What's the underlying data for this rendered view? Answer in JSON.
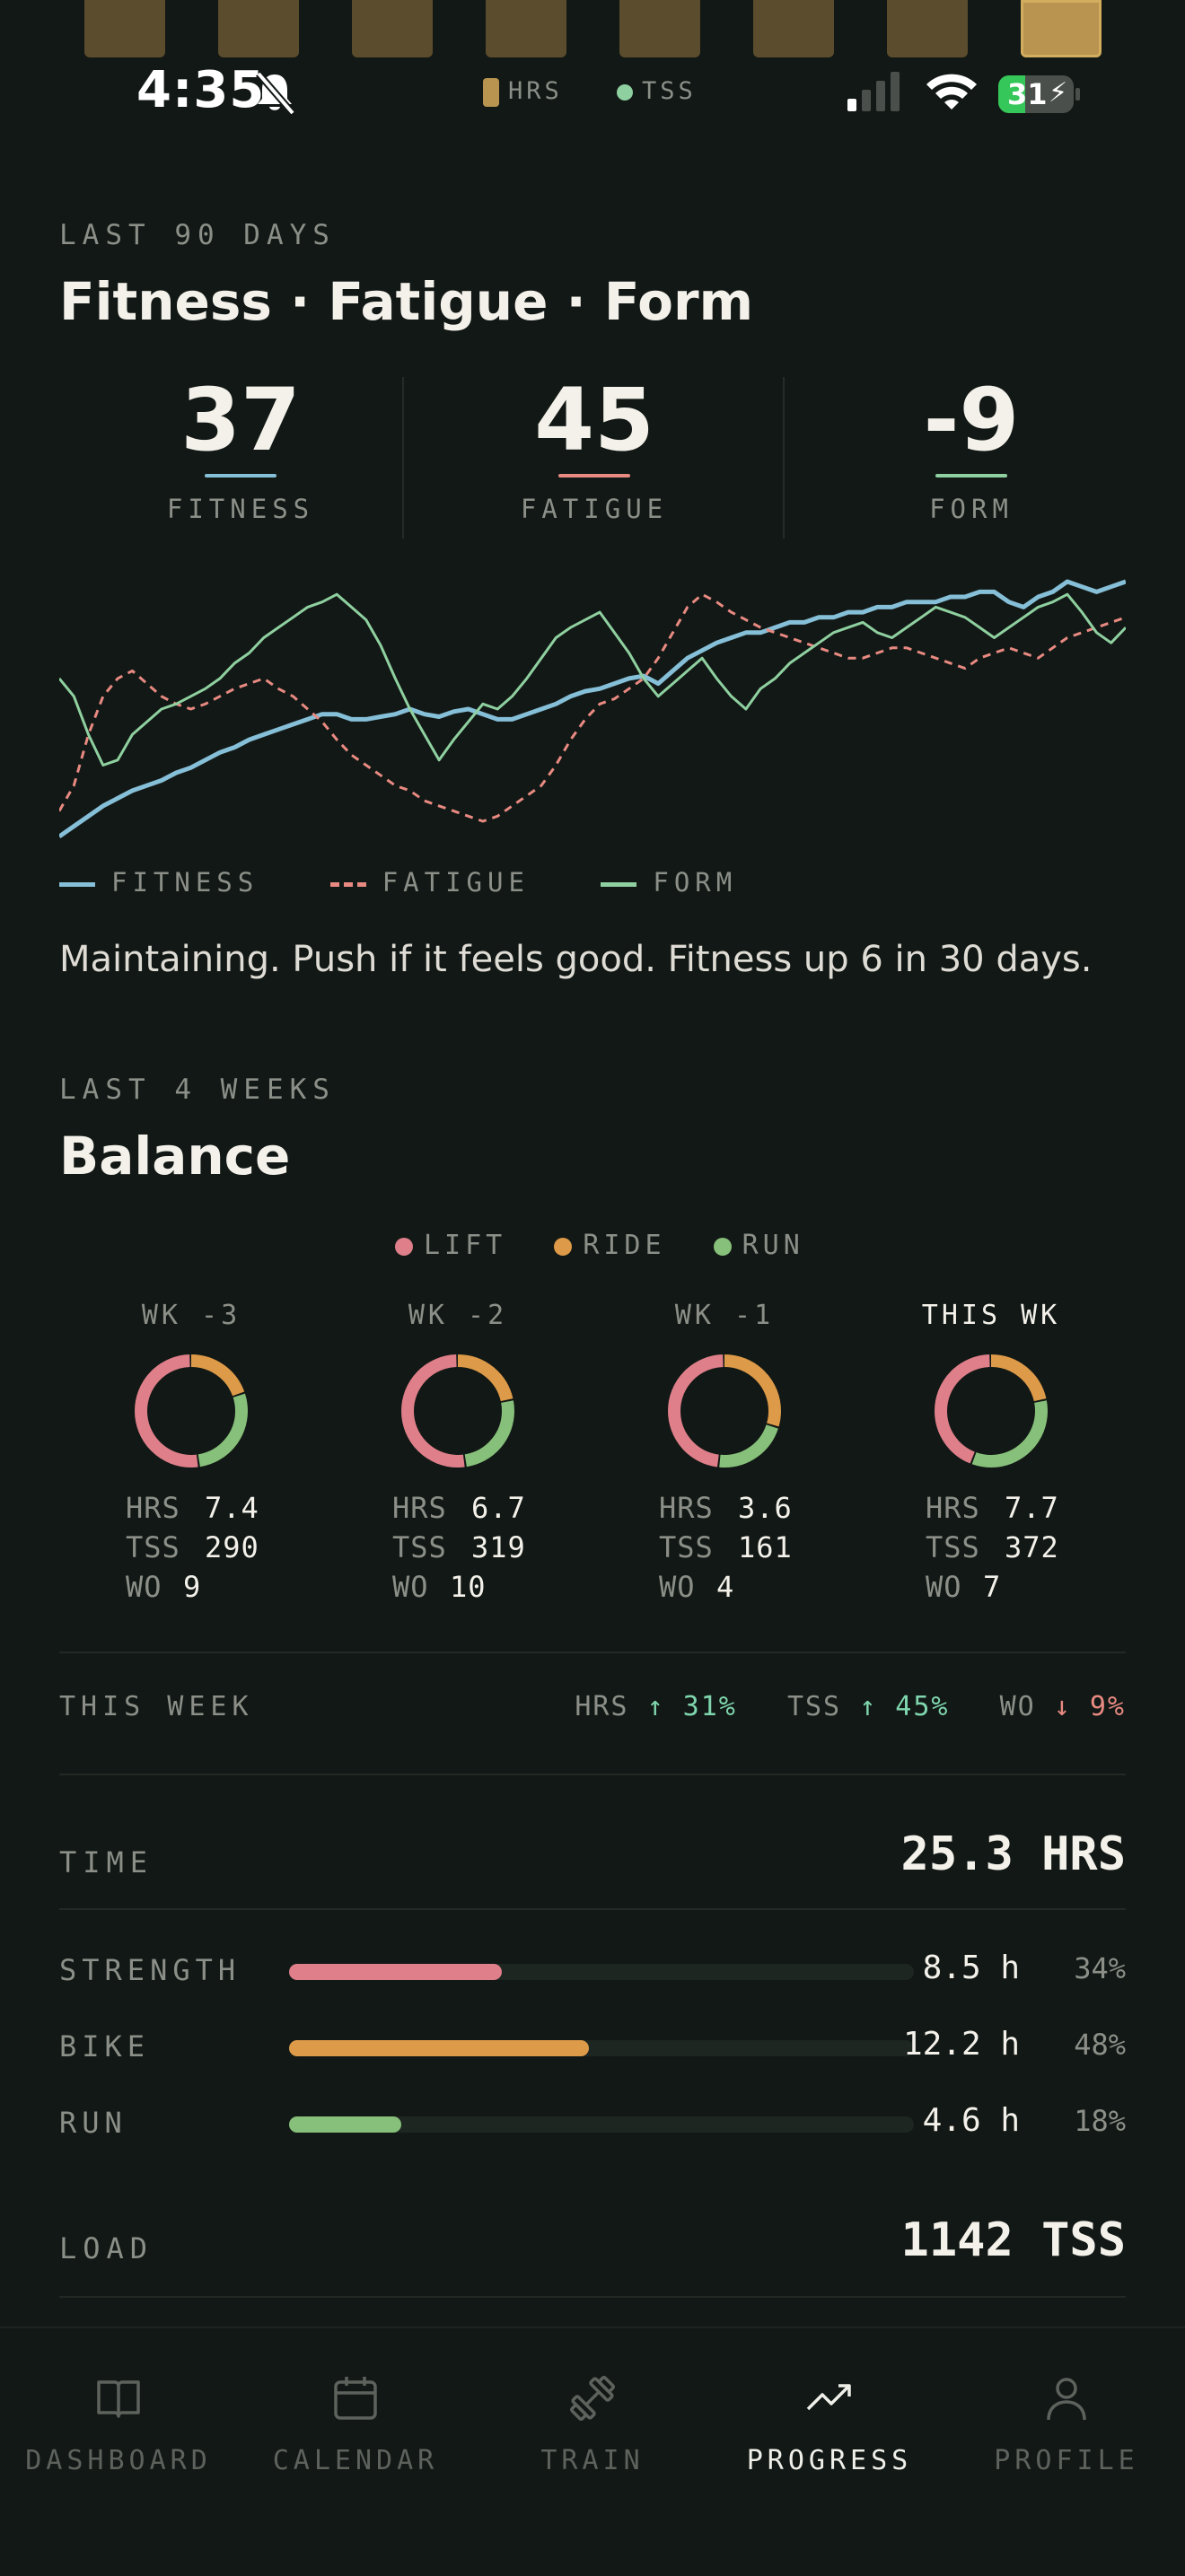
{
  "status": {
    "time": "4:35",
    "battery": "31",
    "legend_hrs": "HRS",
    "legend_tss": "TSS"
  },
  "colors": {
    "fitness": "#86bfd8",
    "fatigue": "#e88a82",
    "form": "#8fd0a0",
    "lift": "#de7f8a",
    "ride": "#dd9a48",
    "run": "#86c07a",
    "up": "#7fd6ae",
    "down": "#e88a82",
    "bar_week": "#5a4c2c",
    "bar_week_current": "#b89450"
  },
  "fff": {
    "eyebrow": "LAST 90 DAYS",
    "title": "Fitness · Fatigue · Form",
    "stats": [
      {
        "value": "37",
        "label": "FITNESS"
      },
      {
        "value": "45",
        "label": "FATIGUE"
      },
      {
        "value": "-9",
        "label": "FORM"
      }
    ],
    "legend": [
      "FITNESS",
      "FATIGUE",
      "FORM"
    ],
    "summary": "Maintaining. Push if it feels good. Fitness up 6 in 30 days."
  },
  "chart_data": {
    "type": "line",
    "title": "",
    "ylim": [
      0,
      100
    ],
    "series": [
      {
        "name": "FITNESS",
        "values": [
          0,
          4,
          8,
          12,
          15,
          18,
          20,
          22,
          25,
          27,
          30,
          33,
          35,
          38,
          40,
          42,
          44,
          46,
          48,
          48,
          46,
          46,
          47,
          48,
          50,
          48,
          47,
          49,
          50,
          48,
          46,
          46,
          48,
          50,
          52,
          55,
          57,
          58,
          60,
          62,
          63,
          60,
          65,
          70,
          73,
          76,
          78,
          80,
          80,
          82,
          84,
          84,
          86,
          86,
          88,
          88,
          90,
          90,
          92,
          92,
          92,
          94,
          94,
          96,
          96,
          92,
          90,
          94,
          96,
          100,
          98,
          96,
          98,
          100
        ]
      },
      {
        "name": "FATIGUE",
        "values": [
          10,
          20,
          40,
          55,
          62,
          65,
          60,
          55,
          52,
          50,
          52,
          55,
          58,
          60,
          62,
          58,
          55,
          50,
          45,
          38,
          32,
          28,
          24,
          20,
          18,
          14,
          12,
          10,
          8,
          6,
          8,
          12,
          16,
          20,
          28,
          38,
          46,
          52,
          54,
          58,
          62,
          70,
          80,
          90,
          95,
          92,
          88,
          85,
          82,
          80,
          78,
          76,
          74,
          72,
          70,
          70,
          72,
          74,
          74,
          72,
          70,
          68,
          66,
          70,
          72,
          74,
          72,
          70,
          74,
          78,
          80,
          82,
          84,
          86
        ]
      },
      {
        "name": "FORM",
        "values": [
          62,
          55,
          40,
          28,
          30,
          40,
          45,
          50,
          52,
          55,
          58,
          62,
          68,
          72,
          78,
          82,
          86,
          90,
          92,
          95,
          90,
          85,
          75,
          62,
          50,
          40,
          30,
          38,
          45,
          52,
          50,
          55,
          62,
          70,
          78,
          82,
          85,
          88,
          80,
          72,
          62,
          55,
          60,
          65,
          70,
          62,
          55,
          50,
          58,
          62,
          68,
          72,
          76,
          80,
          82,
          84,
          80,
          78,
          82,
          86,
          90,
          88,
          86,
          82,
          78,
          82,
          86,
          90,
          92,
          95,
          88,
          80,
          76,
          82
        ]
      }
    ]
  },
  "balance": {
    "eyebrow": "LAST 4 WEEKS",
    "title": "Balance",
    "legend": [
      "LIFT",
      "RIDE",
      "RUN"
    ],
    "weeks": [
      {
        "label": "WK -3",
        "lift": 52,
        "ride": 20,
        "run": 28,
        "hrs": "7.4",
        "tss": "290",
        "wo": "9"
      },
      {
        "label": "WK -2",
        "lift": 52,
        "ride": 22,
        "run": 26,
        "hrs": "6.7",
        "tss": "319",
        "wo": "10"
      },
      {
        "label": "WK -1",
        "lift": 48,
        "ride": 30,
        "run": 22,
        "hrs": "3.6",
        "tss": "161",
        "wo": "4"
      },
      {
        "label": "THIS WK",
        "lift": 44,
        "ride": 22,
        "run": 34,
        "hrs": "7.7",
        "tss": "372",
        "wo": "7"
      }
    ],
    "keys": {
      "hrs": "HRS",
      "tss": "TSS",
      "wo": "WO"
    }
  },
  "this_week": {
    "label": "THIS WEEK",
    "hrs_label": "HRS",
    "hrs_change": "↑ 31%",
    "tss_label": "TSS",
    "tss_change": "↑ 45%",
    "wo_label": "WO",
    "wo_change": "↓ 9%"
  },
  "time": {
    "label": "TIME",
    "total": "25.3 HRS",
    "rows": [
      {
        "label": "STRENGTH",
        "value": "8.5 h",
        "pct": "34%",
        "fraction": 0.34
      },
      {
        "label": "BIKE",
        "value": "12.2 h",
        "pct": "48%",
        "fraction": 0.48
      },
      {
        "label": "RUN",
        "value": "4.6 h",
        "pct": "18%",
        "fraction": 0.18
      }
    ]
  },
  "load": {
    "label": "LOAD",
    "total": "1142 TSS"
  },
  "nav": [
    {
      "label": "DASHBOARD",
      "icon": "book-icon"
    },
    {
      "label": "CALENDAR",
      "icon": "calendar-icon"
    },
    {
      "label": "TRAIN",
      "icon": "dumbbell-icon"
    },
    {
      "label": "PROGRESS",
      "icon": "trend-icon"
    },
    {
      "label": "PROFILE",
      "icon": "person-icon"
    }
  ]
}
